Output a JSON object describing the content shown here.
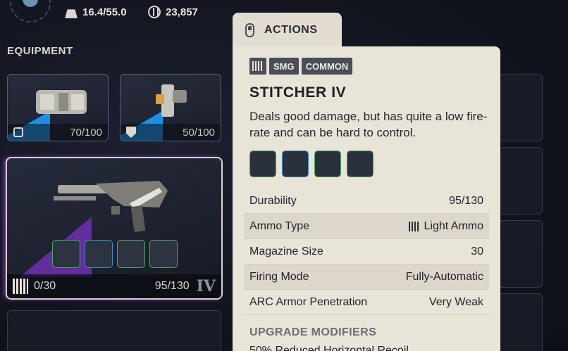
{
  "hud": {
    "weight": "16.4/55.0",
    "currency": "23,857"
  },
  "equipment": {
    "title": "EQUIPMENT",
    "slots": [
      {
        "durability": "70/100",
        "icon": "link-icon"
      },
      {
        "durability": "50/100",
        "icon": "shield-icon"
      }
    ],
    "weapon": {
      "ammo": "0/30",
      "durability": "95/130",
      "tier": "IV"
    }
  },
  "actions_tab": {
    "label": "ACTIONS"
  },
  "tooltip": {
    "tags": [
      "SMG",
      "COMMON"
    ],
    "name": "STITCHER IV",
    "description": "Deals good damage, but has quite a low fire-rate and can be hard to control.",
    "stats": [
      {
        "label": "Durability",
        "value": "95/130"
      },
      {
        "label": "Ammo Type",
        "value": "Light Ammo"
      },
      {
        "label": "Magazine Size",
        "value": "30"
      },
      {
        "label": "Firing Mode",
        "value": "Fully-Automatic"
      },
      {
        "label": "ARC Armor Penetration",
        "value": "Very Weak"
      }
    ],
    "upgrade_title": "UPGRADE MODIFIERS",
    "upgrade_line": "50% Reduced Horizontal Recoil"
  }
}
